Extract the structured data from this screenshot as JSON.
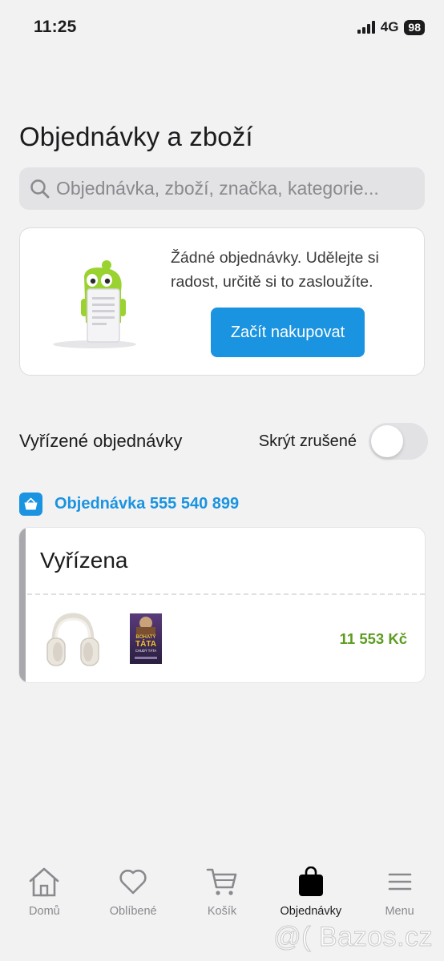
{
  "status_bar": {
    "time": "11:25",
    "network": "4G",
    "battery": "98"
  },
  "page": {
    "title": "Objednávky a zboží",
    "search_placeholder": "Objednávka, zboží, značka, kategorie..."
  },
  "empty_state": {
    "message": "Žádné objednávky. Udělejte si radost, určitě si to zasloužíte.",
    "cta_label": "Začít nakupovat"
  },
  "completed_section": {
    "title": "Vyřízené objednávky",
    "hide_cancelled_label": "Skrýt zrušené",
    "hide_cancelled_on": false
  },
  "order": {
    "title": "Objednávka 555 540 899",
    "status": "Vyřízena",
    "price": "11 553 Kč",
    "items": [
      {
        "icon": "headphones-image"
      },
      {
        "icon": "book-cover-image",
        "cover_text": [
          "BOHATÝ",
          "TÁTA",
          "CHUDÝ TÁTA"
        ]
      }
    ]
  },
  "tab_bar": {
    "tabs": [
      {
        "label": "Domů",
        "icon": "home-icon",
        "active": false
      },
      {
        "label": "Oblíbené",
        "icon": "heart-icon",
        "active": false
      },
      {
        "label": "Košík",
        "icon": "cart-icon",
        "active": false
      },
      {
        "label": "Objednávky",
        "icon": "bag-icon",
        "active": true
      },
      {
        "label": "Menu",
        "icon": "menu-icon",
        "active": false
      }
    ]
  },
  "watermark": "@( Bazos.cz",
  "colors": {
    "accent": "#1a93e0",
    "price": "#5c9d1f",
    "background": "#f2f2f3"
  }
}
